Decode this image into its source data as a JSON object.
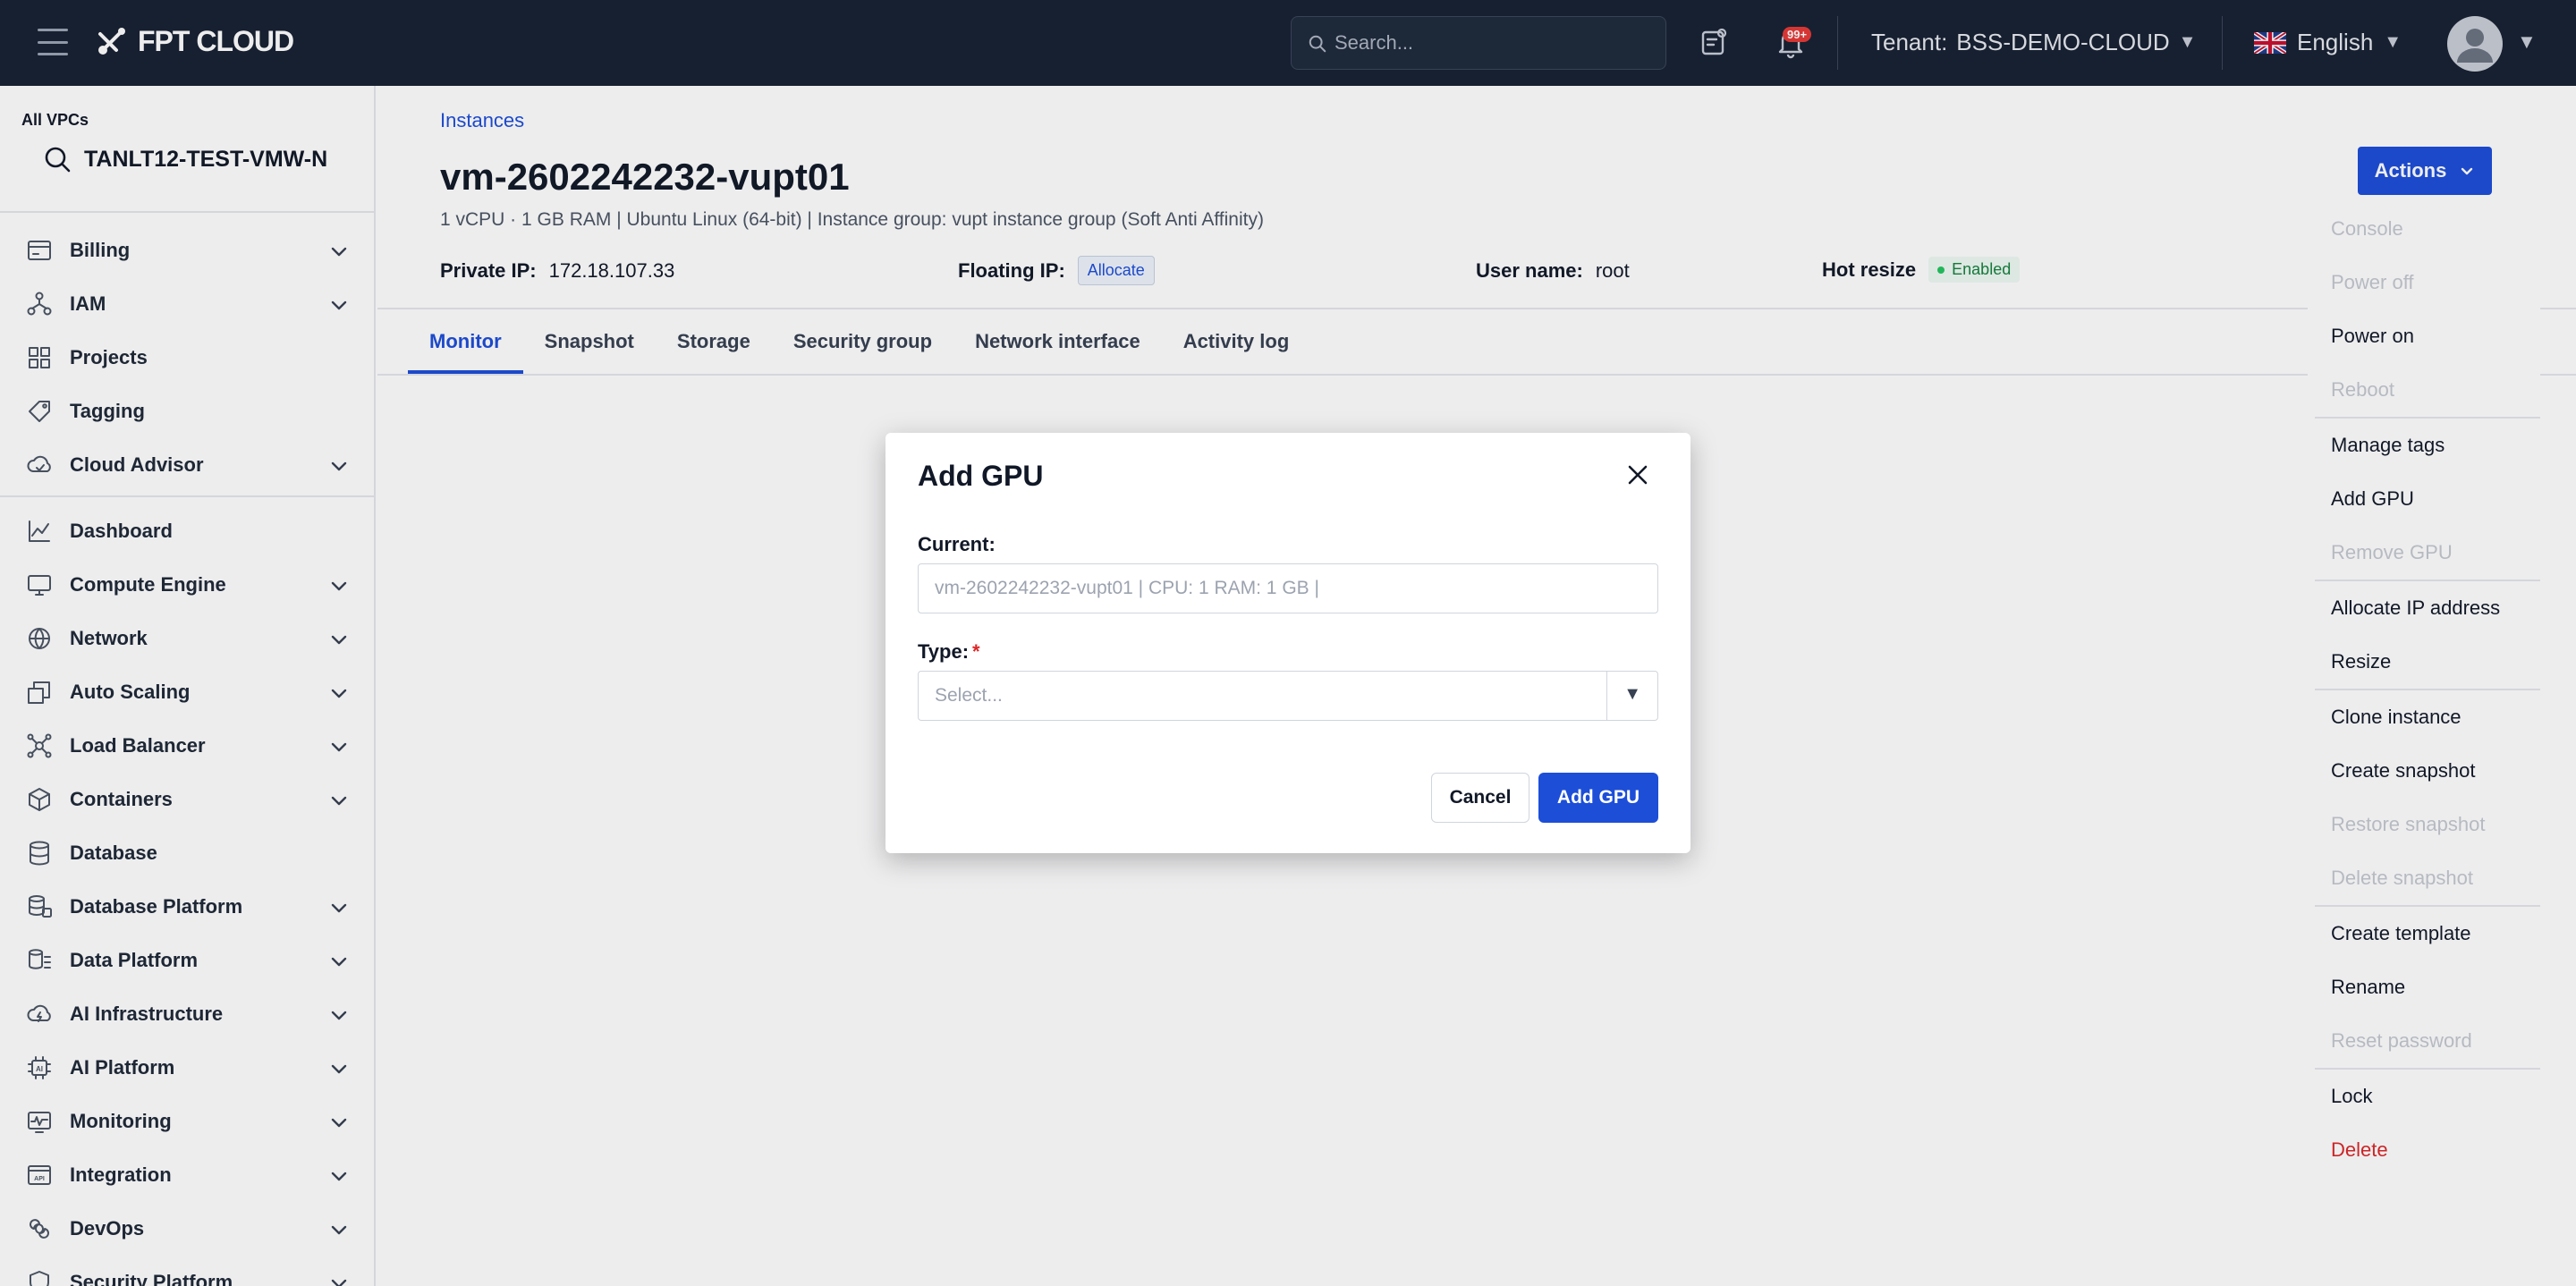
{
  "topbar": {
    "logo_text": "FPT CLOUD",
    "search_placeholder": "Search...",
    "notification_count": "99+",
    "tenant_label": "Tenant:",
    "tenant_value": "BSS-DEMO-CLOUD",
    "language": "English"
  },
  "sidebar": {
    "vpc_label": "All VPCs",
    "vpc_name": "TANLT12-TEST-VMW-N",
    "items_group1": [
      {
        "label": "Billing",
        "icon": "billing-icon",
        "expandable": true
      },
      {
        "label": "IAM",
        "icon": "iam-icon",
        "expandable": true
      },
      {
        "label": "Projects",
        "icon": "projects-icon",
        "expandable": false
      },
      {
        "label": "Tagging",
        "icon": "tag-icon",
        "expandable": false
      },
      {
        "label": "Cloud Advisor",
        "icon": "cloud-advisor-icon",
        "expandable": true
      }
    ],
    "items_group2": [
      {
        "label": "Dashboard",
        "icon": "dashboard-icon",
        "expandable": false
      },
      {
        "label": "Compute Engine",
        "icon": "compute-icon",
        "expandable": true
      },
      {
        "label": "Network",
        "icon": "network-icon",
        "expandable": true
      },
      {
        "label": "Auto Scaling",
        "icon": "auto-scaling-icon",
        "expandable": true
      },
      {
        "label": "Load Balancer",
        "icon": "load-balancer-icon",
        "expandable": true
      },
      {
        "label": "Containers",
        "icon": "containers-icon",
        "expandable": true
      },
      {
        "label": "Database",
        "icon": "database-icon",
        "expandable": false
      },
      {
        "label": "Database Platform",
        "icon": "database-platform-icon",
        "expandable": true
      },
      {
        "label": "Data Platform",
        "icon": "data-platform-icon",
        "expandable": true
      },
      {
        "label": "AI Infrastructure",
        "icon": "ai-infrastructure-icon",
        "expandable": true
      },
      {
        "label": "AI Platform",
        "icon": "ai-platform-icon",
        "expandable": true
      },
      {
        "label": "Monitoring",
        "icon": "monitoring-icon",
        "expandable": true
      },
      {
        "label": "Integration",
        "icon": "integration-icon",
        "expandable": true
      },
      {
        "label": "DevOps",
        "icon": "devops-icon",
        "expandable": true
      },
      {
        "label": "Security Platform",
        "icon": "security-icon",
        "expandable": true
      }
    ]
  },
  "header": {
    "breadcrumb": "Instances",
    "title": "vm-2602242232-vupt01",
    "subtitle": "1 vCPU · 1 GB RAM | Ubuntu Linux (64-bit) | Instance group: vupt instance group (Soft Anti Affinity)",
    "private_ip_label": "Private IP:",
    "private_ip_value": "172.18.107.33",
    "floating_ip_label": "Floating IP:",
    "floating_ip_action": "Allocate",
    "user_name_label": "User name:",
    "user_name_value": "root",
    "hot_resize_label": "Hot resize",
    "hot_resize_value": "Enabled"
  },
  "tabs": [
    "Monitor",
    "Snapshot",
    "Storage",
    "Security group",
    "Network interface",
    "Activity log"
  ],
  "actions": {
    "button_label": "Actions",
    "menu": [
      {
        "label": "Console",
        "disabled": true
      },
      {
        "label": "Power off",
        "disabled": true
      },
      {
        "label": "Power on",
        "disabled": false
      },
      {
        "label": "Reboot",
        "disabled": true
      },
      {
        "label": "Manage tags",
        "disabled": false
      },
      {
        "label": "Add GPU",
        "disabled": false
      },
      {
        "label": "Remove GPU",
        "disabled": true
      },
      {
        "label": "Allocate IP address",
        "disabled": false
      },
      {
        "label": "Resize",
        "disabled": false
      },
      {
        "label": "Clone instance",
        "disabled": false
      },
      {
        "label": "Create snapshot",
        "disabled": false
      },
      {
        "label": "Restore snapshot",
        "disabled": true
      },
      {
        "label": "Delete snapshot",
        "disabled": true
      },
      {
        "label": "Create template",
        "disabled": false
      },
      {
        "label": "Rename",
        "disabled": false
      },
      {
        "label": "Reset password",
        "disabled": true
      },
      {
        "label": "Lock",
        "disabled": false
      },
      {
        "label": "Delete",
        "disabled": false,
        "danger": true
      }
    ]
  },
  "modal": {
    "title": "Add GPU",
    "current_label": "Current:",
    "current_value": "vm-2602242232-vupt01 | CPU: 1 RAM: 1 GB |",
    "type_label": "Type:",
    "type_required": "*",
    "type_placeholder": "Select...",
    "cancel_label": "Cancel",
    "submit_label": "Add GPU"
  },
  "colors": {
    "topbar_bg": "#172131",
    "primary": "#1d4ed8",
    "danger": "#dc2626",
    "success": "#15803d"
  }
}
